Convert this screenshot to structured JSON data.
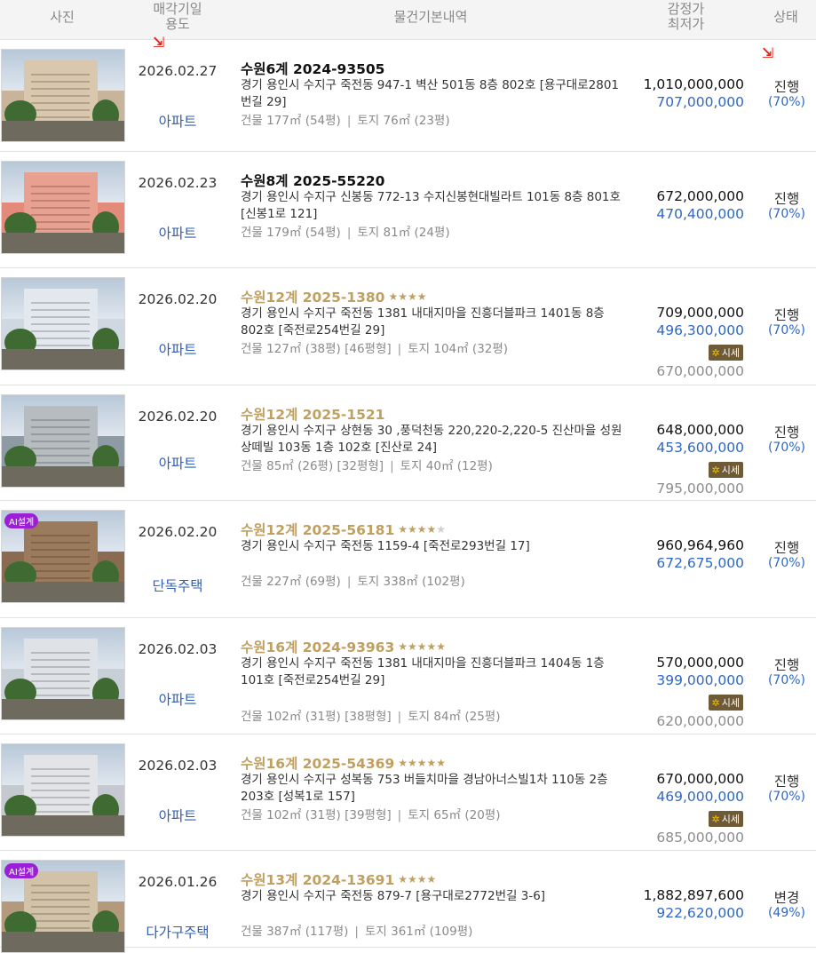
{
  "header": {
    "photo": "사진",
    "date_line1": "매각기일",
    "date_line2": "용도",
    "info": "물건기본내역",
    "price_line1": "감정가",
    "price_line2": "최저가",
    "status": "상태"
  },
  "badges": {
    "ai": "AI설계",
    "market": "시세",
    "market_icon": "✲"
  },
  "rows": [
    {
      "date": "2026.02.27",
      "usage": "아파트",
      "case": "수원6계 2024-93505",
      "stars": 0,
      "address": "경기 용인시 수지구 죽전동 947-1 벽산 501동 8층 802호 [용구대로2801번길 29]",
      "area": [
        "건물 177㎡ (54평)",
        "토지 76㎡ (23평)"
      ],
      "appraisal": "1,010,000,000",
      "minimum": "707,000,000",
      "market": "",
      "status": "진행",
      "pct": "(70%)"
    },
    {
      "date": "2026.02.23",
      "usage": "아파트",
      "case": "수원8계 2025-55220",
      "stars": 0,
      "address": "경기 용인시 수지구 신봉동 772-13 수지신봉현대빌라트 101동 8층 801호 [신봉1로 121]",
      "area": [
        "건물 179㎡ (54평)",
        "토지 81㎡ (24평)"
      ],
      "appraisal": "672,000,000",
      "minimum": "470,400,000",
      "market": "",
      "status": "진행",
      "pct": "(70%)"
    },
    {
      "date": "2026.02.20",
      "usage": "아파트",
      "case": "수원12계 2025-1380",
      "stars": 4,
      "address": "경기 용인시 수지구 죽전동 1381 내대지마을 진흥더블파크 1401동 8층 802호 [죽전로254번길 29]",
      "area": [
        "건물 127㎡ (38평) [46평형]",
        "토지 104㎡ (32평)"
      ],
      "appraisal": "709,000,000",
      "minimum": "496,300,000",
      "market": "670,000,000",
      "status": "진행",
      "pct": "(70%)"
    },
    {
      "date": "2026.02.20",
      "usage": "아파트",
      "case": "수원12계 2025-1521",
      "stars": 0,
      "address": "경기 용인시 수지구 상현동 30 ,풍덕천동 220,220-2,220-5 진산마을 성원상떼빌 103동 1층 102호 [진산로 24]",
      "area": [
        "건물 85㎡ (26평) [32평형]",
        "토지 40㎡ (12평)"
      ],
      "appraisal": "648,000,000",
      "minimum": "453,600,000",
      "market": "795,000,000",
      "status": "진행",
      "pct": "(70%)"
    },
    {
      "date": "2026.02.20",
      "usage": "단독주택",
      "case": "수원12계 2025-56181",
      "stars": 4,
      "stars_total": 5,
      "address": "경기 용인시 수지구 죽전동 1159-4 [죽전로293번길 17]",
      "area": [
        "건물 227㎡ (69평)",
        "토지 338㎡ (102평)"
      ],
      "appraisal": "960,964,960",
      "minimum": "672,675,000",
      "market": "",
      "status": "진행",
      "pct": "(70%)",
      "ai": true
    },
    {
      "date": "2026.02.03",
      "usage": "아파트",
      "case": "수원16계 2024-93963",
      "stars": 5,
      "address": "경기 용인시 수지구 죽전동 1381 내대지마을 진흥더블파크 1404동 1층 101호 [죽전로254번길 29]",
      "area": [
        "건물 102㎡ (31평) [38평형]",
        "토지 84㎡ (25평)"
      ],
      "appraisal": "570,000,000",
      "minimum": "399,000,000",
      "market": "620,000,000",
      "status": "진행",
      "pct": "(70%)"
    },
    {
      "date": "2026.02.03",
      "usage": "아파트",
      "case": "수원16계 2025-54369",
      "stars": 5,
      "address": "경기 용인시 수지구 성복동 753 버들치마을 경남아너스빌1차 110동 2층 203호 [성복1로 157]",
      "area": [
        "건물 102㎡ (31평) [39평형]",
        "토지 65㎡ (20평)"
      ],
      "appraisal": "670,000,000",
      "minimum": "469,000,000",
      "market": "685,000,000",
      "status": "진행",
      "pct": "(70%)"
    },
    {
      "date": "2026.01.26",
      "usage": "다가구주택",
      "case": "수원13계 2024-13691",
      "stars": 4,
      "address": "경기 용인시 수지구 죽전동 879-7 [용구대로2772번길 3-6]",
      "area": [
        "건물 387㎡ (117평)",
        "토지 361㎡ (109평)"
      ],
      "appraisal": "1,882,897,600",
      "minimum": "922,620,000",
      "market": "",
      "status": "변경",
      "pct": "(49%)",
      "ai": true
    }
  ]
}
